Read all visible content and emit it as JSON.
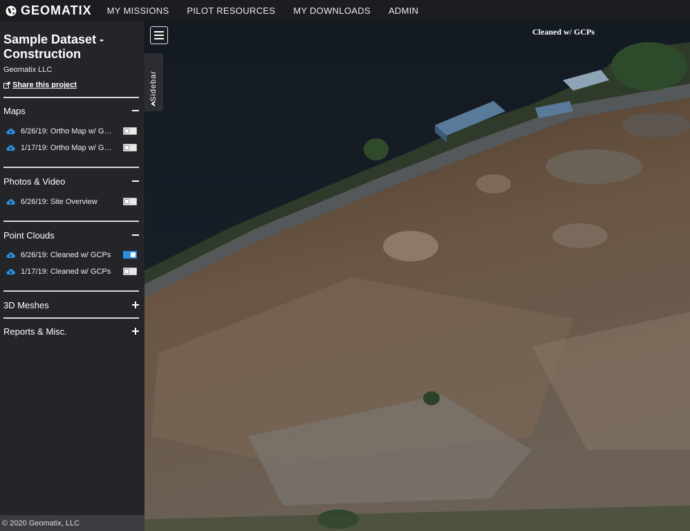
{
  "brand": {
    "name": "GEOMATIX",
    "icon": "globe-icon"
  },
  "nav": {
    "items": [
      {
        "label": "MY MISSIONS"
      },
      {
        "label": "PILOT RESOURCES"
      },
      {
        "label": "MY DOWNLOADS"
      },
      {
        "label": "ADMIN"
      }
    ]
  },
  "project": {
    "title": "Sample Dataset - Construction",
    "org": "Geomatix LLC",
    "share_label": "Share this project"
  },
  "sections": {
    "maps": {
      "title": "Maps",
      "expanded": true,
      "items": [
        {
          "label": "6/26/19: Ortho Map w/ GCPs",
          "enabled": false
        },
        {
          "label": "1/17/19: Ortho Map w/ GCPs",
          "enabled": false
        }
      ]
    },
    "photos": {
      "title": "Photos & Video",
      "expanded": true,
      "items": [
        {
          "label": "6/26/19: Site Overview",
          "enabled": false
        }
      ]
    },
    "pointclouds": {
      "title": "Point Clouds",
      "expanded": true,
      "items": [
        {
          "label": "6/26/19: Cleaned w/ GCPs",
          "enabled": true
        },
        {
          "label": "1/17/19: Cleaned w/ GCPs",
          "enabled": false
        }
      ]
    },
    "meshes": {
      "title": "3D Meshes",
      "expanded": false
    },
    "reports": {
      "title": "Reports & Misc.",
      "expanded": false
    }
  },
  "footer": {
    "text": "© 2020 Geomatix, LLC"
  },
  "viewer": {
    "sidebar_tab_label": "Sidebar",
    "active_layer_label": "Cleaned w/ GCPs"
  },
  "colors": {
    "accent": "#2d8fe0",
    "topbar": "#1b1d20",
    "sidebar": "#232528",
    "footer": "#3a3c3f"
  }
}
